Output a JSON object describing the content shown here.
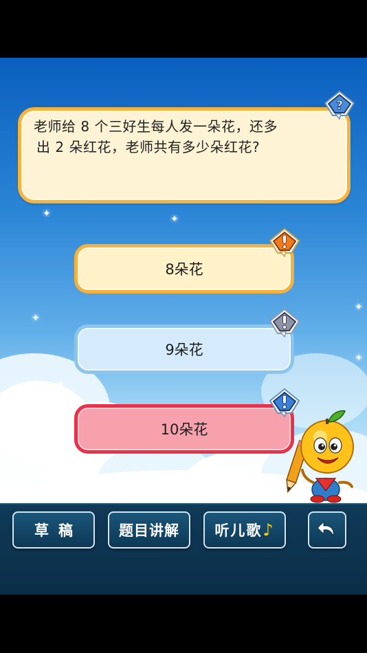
{
  "question": {
    "text": "老师给 8 个三好生每人发一朵花，还多出 2 朵红花，老师共有多少朵红花?",
    "line1": "老师给 8 个三好生每人发一朵花，还多",
    "line2": "出 2 朵红花，老师共有多少朵红花?",
    "badge_icon": "question-mark-icon"
  },
  "options": [
    {
      "label": "8朵花",
      "state": "normal",
      "badge_icon": "exclamation-icon",
      "color": "#f7b13a"
    },
    {
      "label": "9朵花",
      "state": "disabled",
      "badge_icon": "exclamation-icon",
      "color": "#8cc4ee"
    },
    {
      "label": "10朵花",
      "state": "selected",
      "badge_icon": "exclamation-icon",
      "color": "#e8324b"
    }
  ],
  "toolbar": {
    "draft_label": "草稿",
    "explain_label": "题目讲解",
    "song_label": "听儿歌",
    "song_icon": "♪",
    "back_icon": "back-arrow-icon"
  },
  "colors": {
    "accent_orange": "#f9b23a",
    "wrong_red": "#e8324b",
    "toolbar_bg": "#0f3a58"
  }
}
